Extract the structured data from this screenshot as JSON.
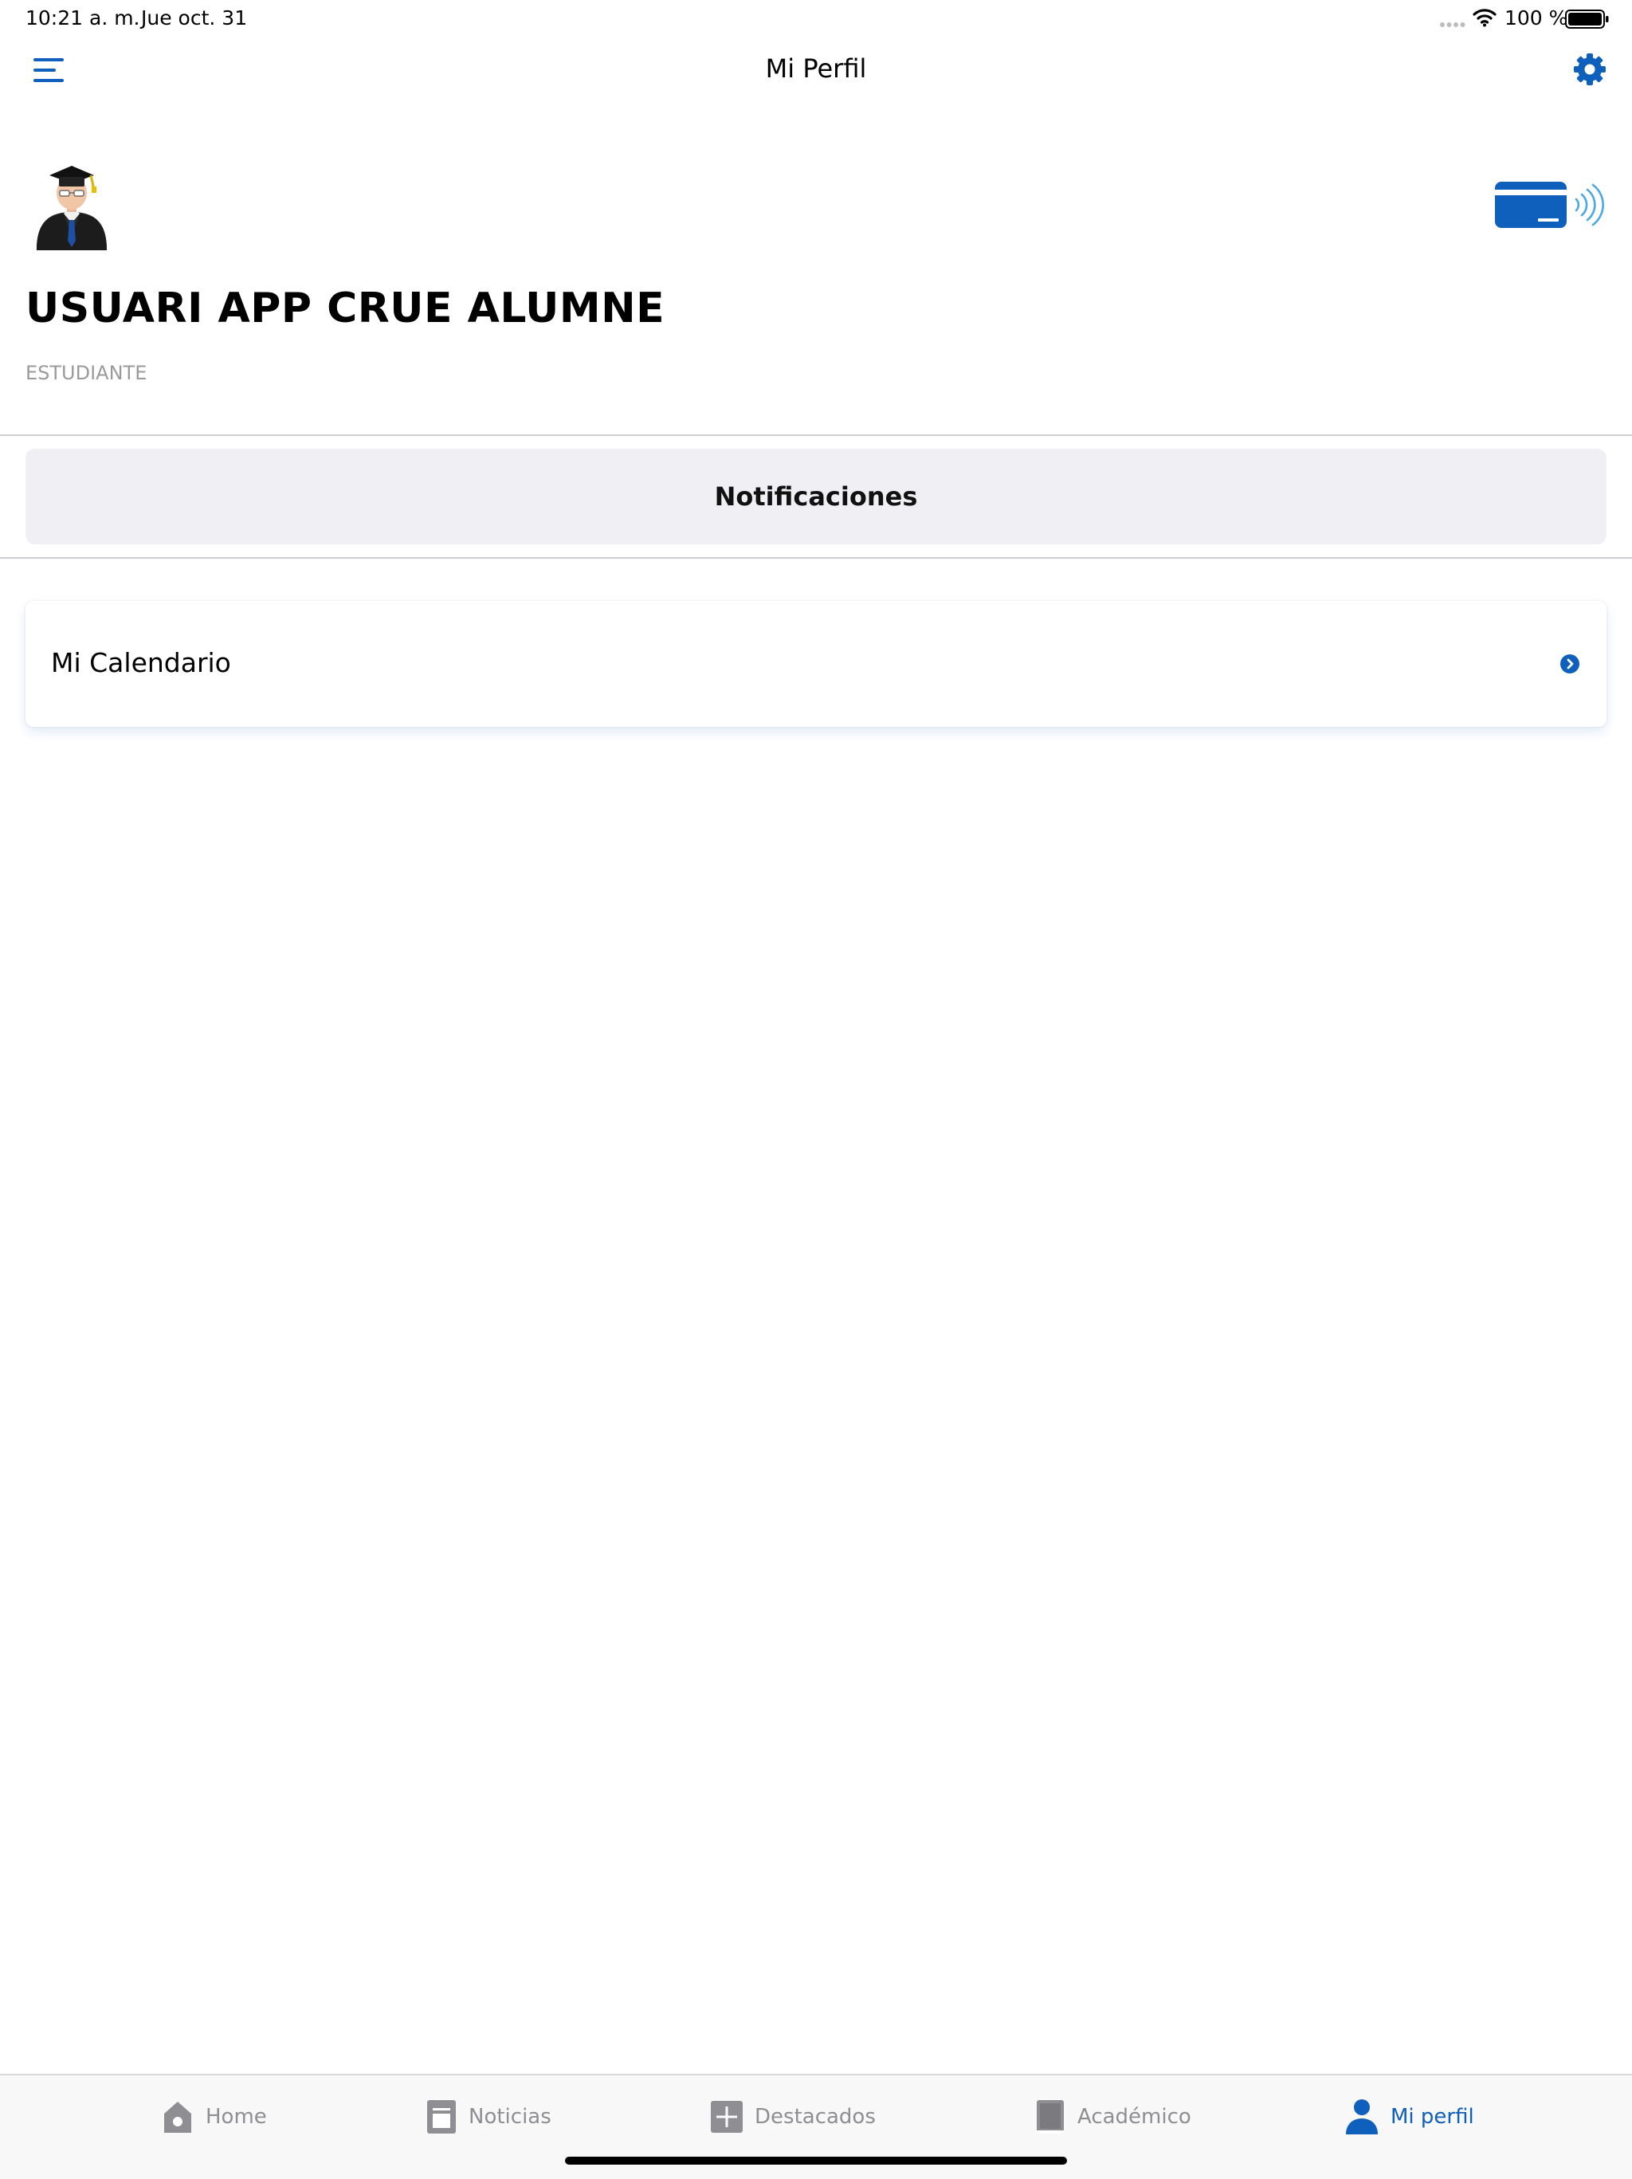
{
  "status_bar": {
    "time": "10:21 a. m.",
    "date": "Jue oct. 31",
    "battery": "100 %",
    "icons": [
      "signal-dots-icon",
      "wifi-icon",
      "battery-icon"
    ]
  },
  "nav_bar": {
    "title": "Mi Perfil",
    "left_icon": "menu-icon",
    "right_icon": "gear-icon"
  },
  "profile": {
    "name": "USUARI APP CRUE ALUMNE",
    "role": "ESTUDIANTE",
    "avatar": "graduate-avatar-icon",
    "card_icon": "contactless-card-icon"
  },
  "notifications_button": {
    "label": "Notificaciones"
  },
  "calendar": {
    "label": "Mi Calendario",
    "icon": "chevron-right-circle-icon"
  },
  "tab_bar": {
    "tabs": [
      {
        "label": "Home",
        "icon": "home-icon",
        "active": false
      },
      {
        "label": "Noticias",
        "icon": "news-icon",
        "active": false
      },
      {
        "label": "Destacados",
        "icon": "plus-square-icon",
        "active": false
      },
      {
        "label": "Académico",
        "icon": "book-icon",
        "active": false
      },
      {
        "label": "Mi perfil",
        "icon": "person-icon",
        "active": true
      }
    ]
  },
  "colors": {
    "accent": "#0f5fbd",
    "inactive": "#8e8e93",
    "button_bg": "#efeff4",
    "contactless": "#4aa8e8"
  }
}
